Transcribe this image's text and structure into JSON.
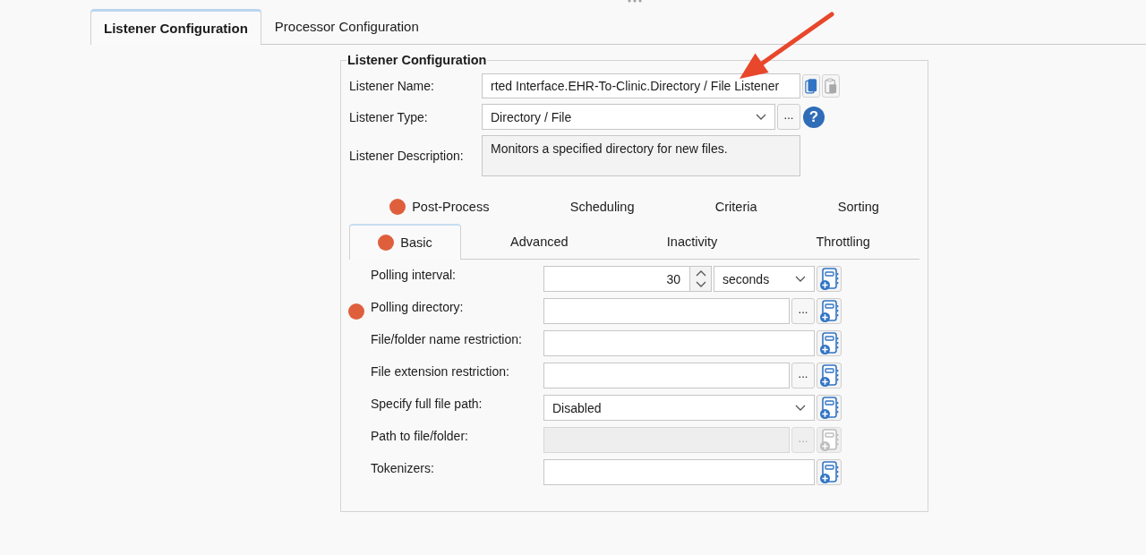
{
  "tabs": [
    {
      "label": "Listener Configuration",
      "selected": true
    },
    {
      "label": "Processor Configuration",
      "selected": false
    }
  ],
  "group": {
    "title": "Listener Configuration",
    "general": [
      {
        "label": "Listener Name:",
        "kind": "text",
        "value": "rted Interface.EHR-To-Clinic.Directory / File Listener",
        "tools": [
          {
            "kind": "copy",
            "disabled": false
          },
          {
            "kind": "paste",
            "disabled": true
          }
        ]
      },
      {
        "label": "Listener Type:",
        "kind": "select",
        "value": "Directory / File",
        "browse": "...",
        "tools": [
          {
            "kind": "help",
            "label": "?",
            "disabled": false
          }
        ]
      },
      {
        "label": "Listener Description:",
        "kind": "textarea",
        "value": "Monitors a specified directory for new files."
      }
    ],
    "subtabs": [
      [
        {
          "label": "Post-Process",
          "selected": false,
          "flagged": true
        },
        {
          "label": "Scheduling",
          "selected": false,
          "flagged": false
        },
        {
          "label": "Criteria",
          "selected": false,
          "flagged": false
        },
        {
          "label": "Sorting",
          "selected": false,
          "flagged": false
        }
      ],
      [
        {
          "label": "Basic",
          "selected": true,
          "flagged": true
        },
        {
          "label": "Advanced",
          "selected": false,
          "flagged": false
        },
        {
          "label": "Inactivity",
          "selected": false,
          "flagged": false
        },
        {
          "label": "Throttling",
          "selected": false,
          "flagged": false
        }
      ]
    ],
    "basic_fields": [
      {
        "label": "Polling interval:",
        "kind": "spin",
        "value": "30",
        "unit": "seconds",
        "flagged": false,
        "disabled": false
      },
      {
        "label": "Polling directory:",
        "kind": "text",
        "browse": "...",
        "flagged": true,
        "disabled": false
      },
      {
        "label": "File/folder name restriction:",
        "kind": "text",
        "flagged": false,
        "disabled": false
      },
      {
        "label": "File extension restriction:",
        "kind": "text",
        "browse": "...",
        "flagged": false,
        "disabled": false
      },
      {
        "label": "Specify full file path:",
        "kind": "select",
        "value": "Disabled",
        "flagged": false,
        "disabled": false
      },
      {
        "label": "Path to file/folder:",
        "kind": "text",
        "browse": "...",
        "flagged": false,
        "disabled": true
      },
      {
        "label": "Tokenizers:",
        "kind": "text",
        "flagged": false,
        "disabled": false
      }
    ]
  }
}
